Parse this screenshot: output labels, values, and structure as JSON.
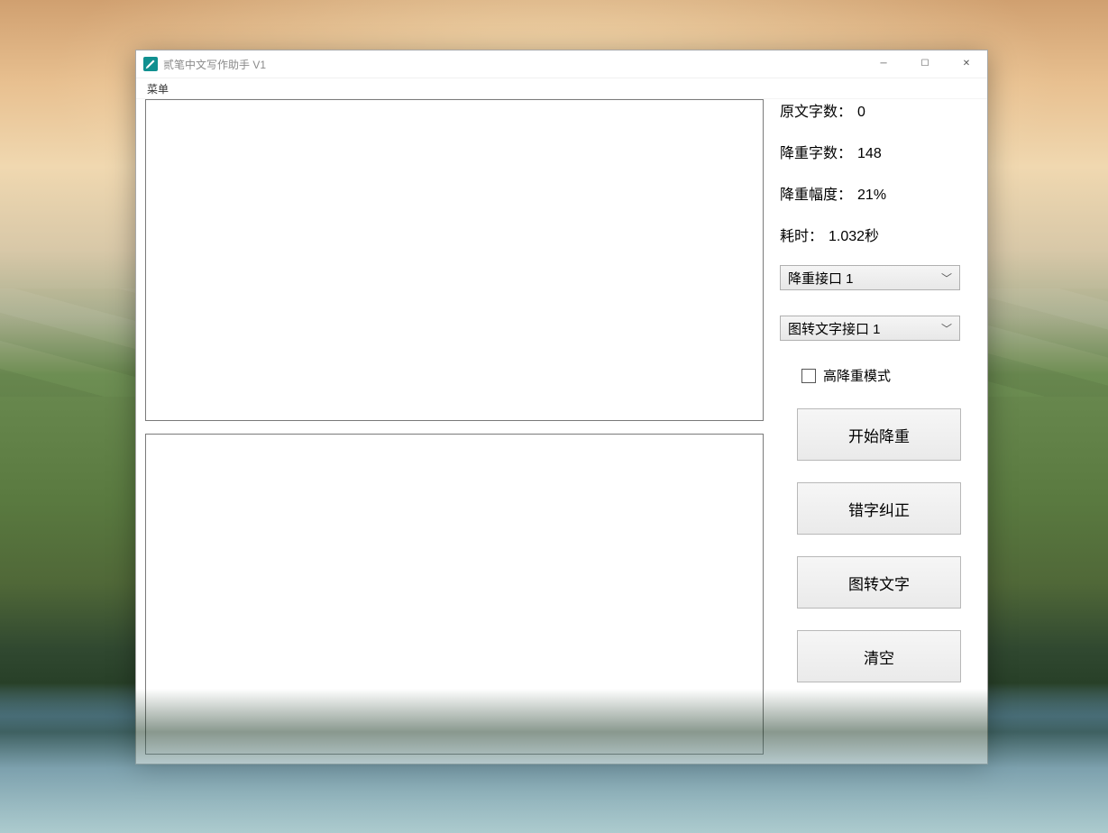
{
  "window": {
    "title": "贰笔中文写作助手 V1",
    "icon_name": "app-icon"
  },
  "menubar": {
    "menu_label": "菜单"
  },
  "stats": {
    "original_label": "原文字数：",
    "original_value": "0",
    "reduced_label": "降重字数：",
    "reduced_value": "148",
    "ratio_label": "降重幅度：",
    "ratio_value": "21%",
    "time_label": "耗时：",
    "time_value": "1.032秒"
  },
  "controls": {
    "reduce_api_selected": "降重接口 1",
    "ocr_api_selected": "图转文字接口 1",
    "high_mode_label": "高降重模式",
    "high_mode_checked": false
  },
  "buttons": {
    "start": "开始降重",
    "correct": "错字纠正",
    "ocr": "图转文字",
    "clear": "清空"
  },
  "text": {
    "source": "",
    "result": ""
  },
  "win_controls": {
    "minimize": "—",
    "maximize": "☐",
    "close": "✕"
  }
}
